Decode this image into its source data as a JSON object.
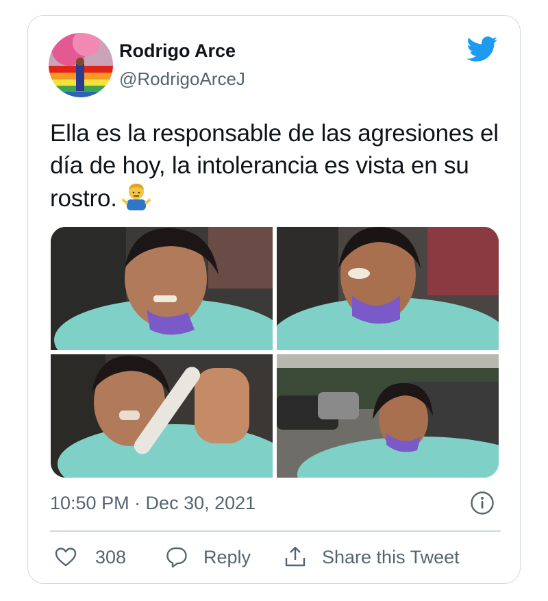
{
  "author": {
    "name": "Rodrigo Arce",
    "handle": "@RodrigoArceJ"
  },
  "tweet": {
    "text": "Ella es la responsable de las agresiones el día de hoy, la intolerancia es vista en su rostro.",
    "emoji": "man-shrugging-emoji"
  },
  "media": [
    {
      "name": "photo-1"
    },
    {
      "name": "photo-2"
    },
    {
      "name": "photo-3"
    },
    {
      "name": "photo-4"
    }
  ],
  "meta": {
    "timestamp": "10:50 PM · Dec 30, 2021"
  },
  "actions": {
    "like_count": "308",
    "reply_label": "Reply",
    "share_label": "Share this Tweet"
  },
  "colors": {
    "twitter_blue": "#1d9bf0",
    "secondary_text": "#536471",
    "border": "#cfd9de"
  }
}
